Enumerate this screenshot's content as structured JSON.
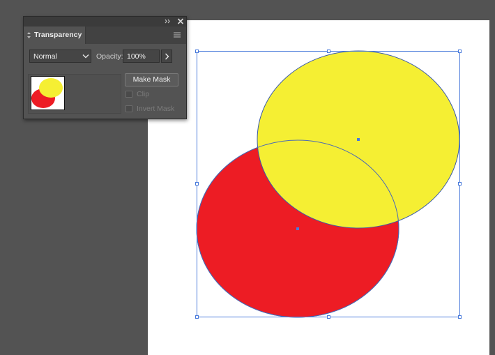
{
  "panel": {
    "tab_title": "Transparency",
    "blend_mode": "Normal",
    "opacity_label": "Opacity:",
    "opacity_value": "100%",
    "make_mask_label": "Make Mask",
    "clip_label": "Clip",
    "invert_mask_label": "Invert Mask",
    "clip_checked": false,
    "invert_mask_checked": false
  },
  "icons": {
    "collapse": "double-chevron-collapse-icon",
    "close": "close-icon",
    "tab_arrows": "tab-collapse-arrows-icon",
    "menu": "panel-menu-icon",
    "dropdown": "chevron-down-icon",
    "opacity_popup": "chevron-right-icon"
  },
  "canvas": {
    "shapes": [
      {
        "type": "ellipse",
        "fill": "#ED1C24",
        "label": "red-ellipse"
      },
      {
        "type": "ellipse",
        "fill": "#F5EF33",
        "label": "yellow-ellipse"
      }
    ],
    "selection_color": "#4A7BDB"
  }
}
